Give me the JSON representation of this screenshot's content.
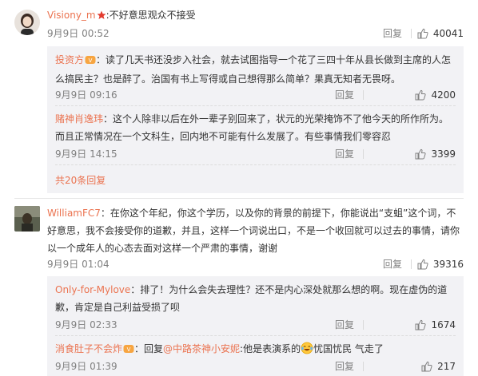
{
  "comments": [
    {
      "user": "Visiony_m",
      "text": ":不好意思观众不接受",
      "time": "9月9日 00:52",
      "reply": "回复",
      "likes": "40041",
      "replies": [
        {
          "user": "投资方",
          "text": "：读了几天书还没步入社会，就去试图指导一个花了三四十年从县长做到主席的人怎么搞民主？也是醉了。治国有书上写得或自己想得那么简单？果真无知者无畏呀。",
          "time": "9月9日 09:16",
          "reply": "回复",
          "likes": "4200"
        },
        {
          "user": "赌神肖逸玮",
          "text": "：这个人除非以后在外一辈子别回来了，状元的光荣掩饰不了他今天的所作所为。而且正常情况在一个文科生，回内地不可能有什么发展了。有些事情我们零容忍",
          "time": "9月9日 14:15",
          "reply": "回复",
          "likes": "3399"
        }
      ],
      "more": "共20条回复"
    },
    {
      "user": "WilliamFC7",
      "text": "：在你这个年纪，你这个学历，以及你的背景的前提下，你能说出“支蛆”这个词，不好意思，我不会接受你的道歉，并且，这样一个词说出口，不是一个收回就可以过去的事情，请你以一个成年人的心态去面对这样一个严肃的事情，谢谢",
      "time": "9月9日 01:04",
      "reply": "回复",
      "likes": "39316",
      "replies": [
        {
          "user": "Only-for-Mylove",
          "text": "：排了！为什么会失去理性？还不是内心深处就那么想的啊。现在虚伪的道歉，肯定是自己利益受损了呗",
          "time": "9月9日 02:33",
          "reply": "回复",
          "likes": "1674"
        },
        {
          "user": "消食肚子不会炸",
          "text_before": "：回复",
          "mention": "@中路茶神小安妮",
          "text_after": ":他是表演系的",
          "text_tail": "忧国忧民 气走了",
          "time": "9月9日 01:39",
          "reply": "回复",
          "likes": "217"
        }
      ]
    }
  ],
  "icons": {
    "vip": "vip-badge-icon",
    "like": "thumbs-up-icon",
    "emoji": "laughing-tears-emoji"
  },
  "colors": {
    "username": "#eb7350",
    "meta": "#808080",
    "sub_bg": "#f2f2f5"
  }
}
